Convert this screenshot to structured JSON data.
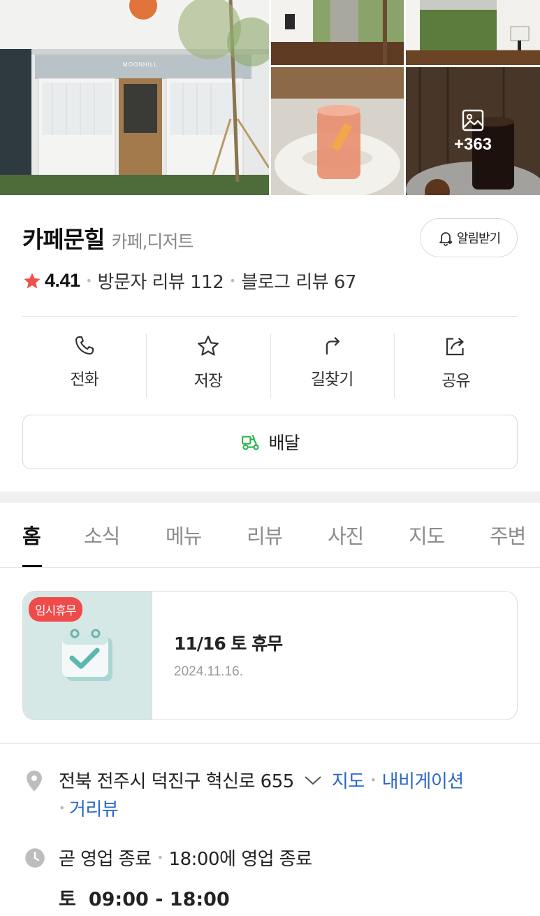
{
  "photos": {
    "main_sign": "MOONHILL",
    "more_count": "+363"
  },
  "place": {
    "name": "카페문힐",
    "category": "카페,디저트",
    "alarm_label": "알림받기"
  },
  "rating": {
    "score": "4.41",
    "visitor_reviews": "방문자 리뷰 112",
    "blog_reviews": "블로그 리뷰 67"
  },
  "actions": [
    {
      "label": "전화",
      "icon": "phone-icon"
    },
    {
      "label": "저장",
      "icon": "star-icon"
    },
    {
      "label": "길찾기",
      "icon": "directions-icon"
    },
    {
      "label": "공유",
      "icon": "share-icon"
    }
  ],
  "delivery": {
    "label": "배달",
    "icon": "delivery-scooter-icon",
    "icon_color": "#2bb34a"
  },
  "tabs": [
    "홈",
    "소식",
    "메뉴",
    "리뷰",
    "사진",
    "지도",
    "주변"
  ],
  "active_tab": "홈",
  "notice": {
    "badge": "임시휴무",
    "badge_color": "#ef4b4b",
    "title": "11/16 토 휴무",
    "date": "2024.11.16."
  },
  "address": {
    "text": "전북 전주시 덕진구 혁신로 655",
    "map_link": "지도",
    "navigation_link": "내비게이션",
    "street_view_link": "거리뷰",
    "link_color": "#2a66c9"
  },
  "hours": {
    "status": "곧 영업 종료",
    "detail": "18:00에 영업 종료",
    "day": "토",
    "time": "09:00 - 18:00"
  }
}
